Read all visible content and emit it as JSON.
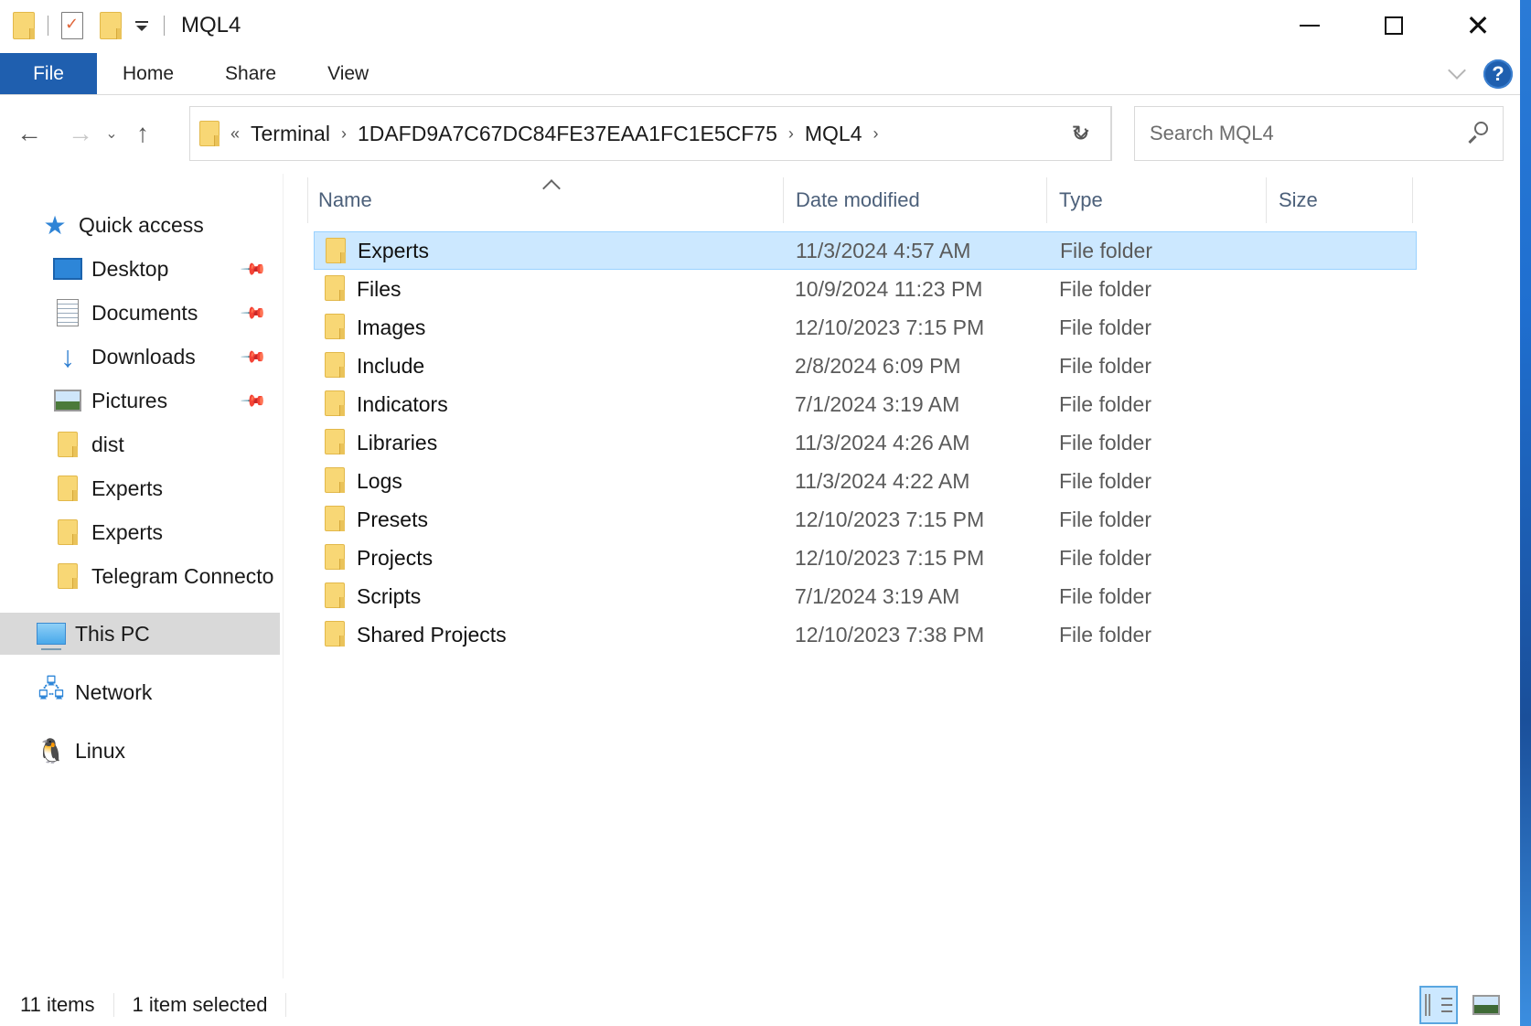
{
  "window": {
    "title": "MQL4",
    "controls": {
      "minimize": "minimize",
      "maximize": "maximize",
      "close": "close"
    }
  },
  "quick_access_toolbar": {
    "icons": [
      "folder-icon",
      "properties-icon",
      "new-folder-icon",
      "customize-dropdown-icon"
    ]
  },
  "ribbon": {
    "tabs": [
      {
        "label": "File",
        "active": true
      },
      {
        "label": "Home"
      },
      {
        "label": "Share"
      },
      {
        "label": "View"
      }
    ],
    "help_glyph": "?"
  },
  "navigation": {
    "back_glyph": "←",
    "forward_glyph": "→",
    "recent_glyph": "⌄",
    "up_glyph": "↑",
    "refresh_glyph": "↻",
    "overflow_glyph": "«",
    "breadcrumbs": [
      "Terminal",
      "1DAFD9A7C67DC84FE37EAA1FC1E5CF75",
      "MQL4"
    ],
    "crumb_separator": "›"
  },
  "search": {
    "placeholder": "Search MQL4",
    "value": ""
  },
  "sidebar": {
    "quick_access": {
      "label": "Quick access"
    },
    "pinned": [
      {
        "label": "Desktop",
        "icon": "desktop-icon"
      },
      {
        "label": "Documents",
        "icon": "documents-icon"
      },
      {
        "label": "Downloads",
        "icon": "downloads-icon"
      },
      {
        "label": "Pictures",
        "icon": "pictures-icon"
      }
    ],
    "recent": [
      {
        "label": "dist"
      },
      {
        "label": "Experts"
      },
      {
        "label": "Experts"
      },
      {
        "label": "Telegram Connecto"
      }
    ],
    "this_pc": {
      "label": "This PC",
      "selected": true
    },
    "network": {
      "label": "Network"
    },
    "linux": {
      "label": "Linux"
    },
    "pin_glyph": "📌"
  },
  "file_list": {
    "columns": {
      "name": "Name",
      "date": "Date modified",
      "type": "Type",
      "size": "Size"
    },
    "sort": {
      "column": "name",
      "direction": "ascending"
    },
    "rows": [
      {
        "name": "Experts",
        "date": "11/3/2024 4:57 AM",
        "type": "File folder",
        "size": "",
        "selected": true
      },
      {
        "name": "Files",
        "date": "10/9/2024 11:23 PM",
        "type": "File folder",
        "size": ""
      },
      {
        "name": "Images",
        "date": "12/10/2023 7:15 PM",
        "type": "File folder",
        "size": ""
      },
      {
        "name": "Include",
        "date": "2/8/2024 6:09 PM",
        "type": "File folder",
        "size": ""
      },
      {
        "name": "Indicators",
        "date": "7/1/2024 3:19 AM",
        "type": "File folder",
        "size": ""
      },
      {
        "name": "Libraries",
        "date": "11/3/2024 4:26 AM",
        "type": "File folder",
        "size": ""
      },
      {
        "name": "Logs",
        "date": "11/3/2024 4:22 AM",
        "type": "File folder",
        "size": ""
      },
      {
        "name": "Presets",
        "date": "12/10/2023 7:15 PM",
        "type": "File folder",
        "size": ""
      },
      {
        "name": "Projects",
        "date": "12/10/2023 7:15 PM",
        "type": "File folder",
        "size": ""
      },
      {
        "name": "Scripts",
        "date": "7/1/2024 3:19 AM",
        "type": "File folder",
        "size": ""
      },
      {
        "name": "Shared Projects",
        "date": "12/10/2023 7:38 PM",
        "type": "File folder",
        "size": ""
      }
    ]
  },
  "status_bar": {
    "item_count": "11 items",
    "selection": "1 item selected",
    "view_modes": [
      {
        "name": "details",
        "active": true
      },
      {
        "name": "large-icons",
        "active": false
      }
    ]
  },
  "colors": {
    "accent": "#1f5faf",
    "selection_bg": "#cce8ff",
    "selection_border": "#99d1ff",
    "folder": "#f8d775",
    "column_header_text": "#4c607a"
  }
}
